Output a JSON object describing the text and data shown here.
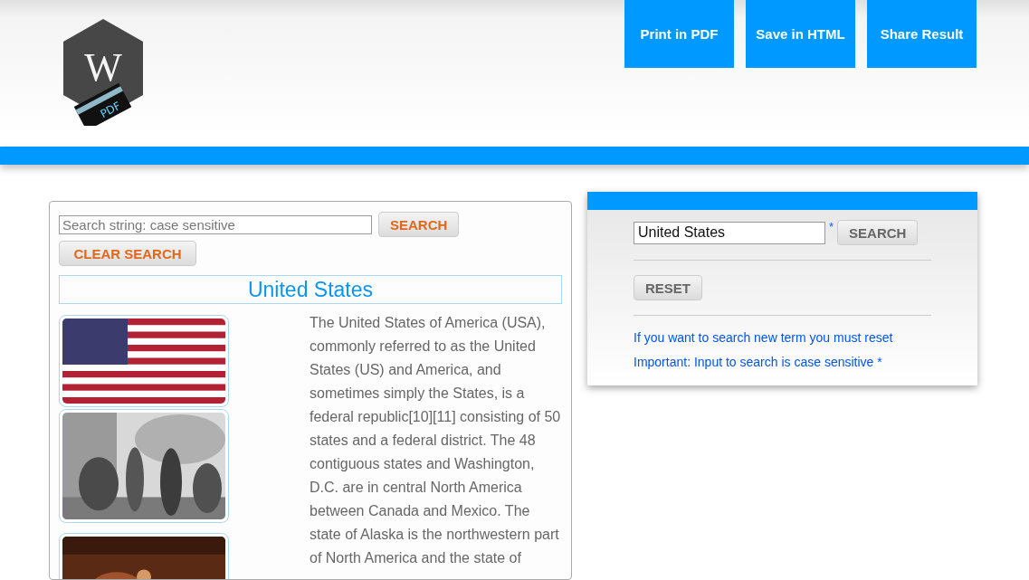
{
  "header": {
    "logo": {
      "letter": "W",
      "badge": "PDF"
    },
    "actions": [
      "Print in PDF",
      "Save in HTML",
      "Share Result"
    ]
  },
  "search_panel": {
    "search_field": {
      "placeholder": "Search string: case sensitive"
    },
    "search_button": "SEARCH",
    "clear_button": "CLEAR SEARCH",
    "article": {
      "title": "United States",
      "images": [
        {
          "kind": "flag"
        },
        {
          "kind": "engraving"
        },
        {
          "kind": "painting"
        }
      ],
      "text": "The United States of America (USA), commonly referred to as the United States (US) and America, and sometimes simply the States, is a federal republic[10][11] consisting of 50 states and a federal district. The 48 contiguous states and Washington, D.C. are in central North America between Canada and Mexico. The state of Alaska is the northwestern part of North America and the state of"
    }
  },
  "side_panel": {
    "search_field": {
      "value": "United States",
      "required_mark": "*"
    },
    "search_button": "SEARCH",
    "reset_button": "RESET",
    "notes": [
      "If you want to search new term you must reset",
      "Important: Input to search is case sensitive *"
    ]
  }
}
